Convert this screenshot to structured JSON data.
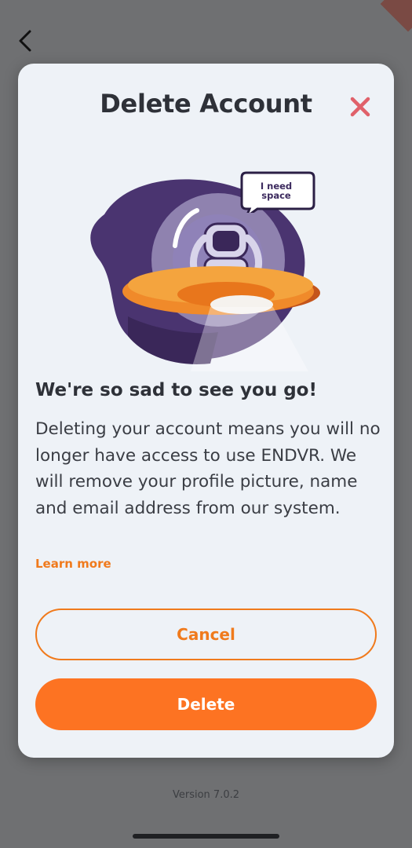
{
  "modal": {
    "title": "Delete Account",
    "speech_bubble": [
      "I need",
      "space"
    ],
    "heading": "We're so sad to see you go!",
    "body": "Deleting your account means you will no longer have access to use ENDVR. We will remove your profile picture, name and email address from our system.",
    "learn_more": "Learn more",
    "cancel_label": "Cancel",
    "delete_label": "Delete"
  },
  "footer": {
    "version": "Version 7.0.2"
  },
  "icons": {
    "back": "chevron-left-icon",
    "close": "close-icon"
  },
  "colors": {
    "accent": "#fd7322",
    "close": "#e0616a",
    "purple": "#4a3470",
    "overlay": "#6f7072",
    "modal_bg": "#eef2f7"
  }
}
